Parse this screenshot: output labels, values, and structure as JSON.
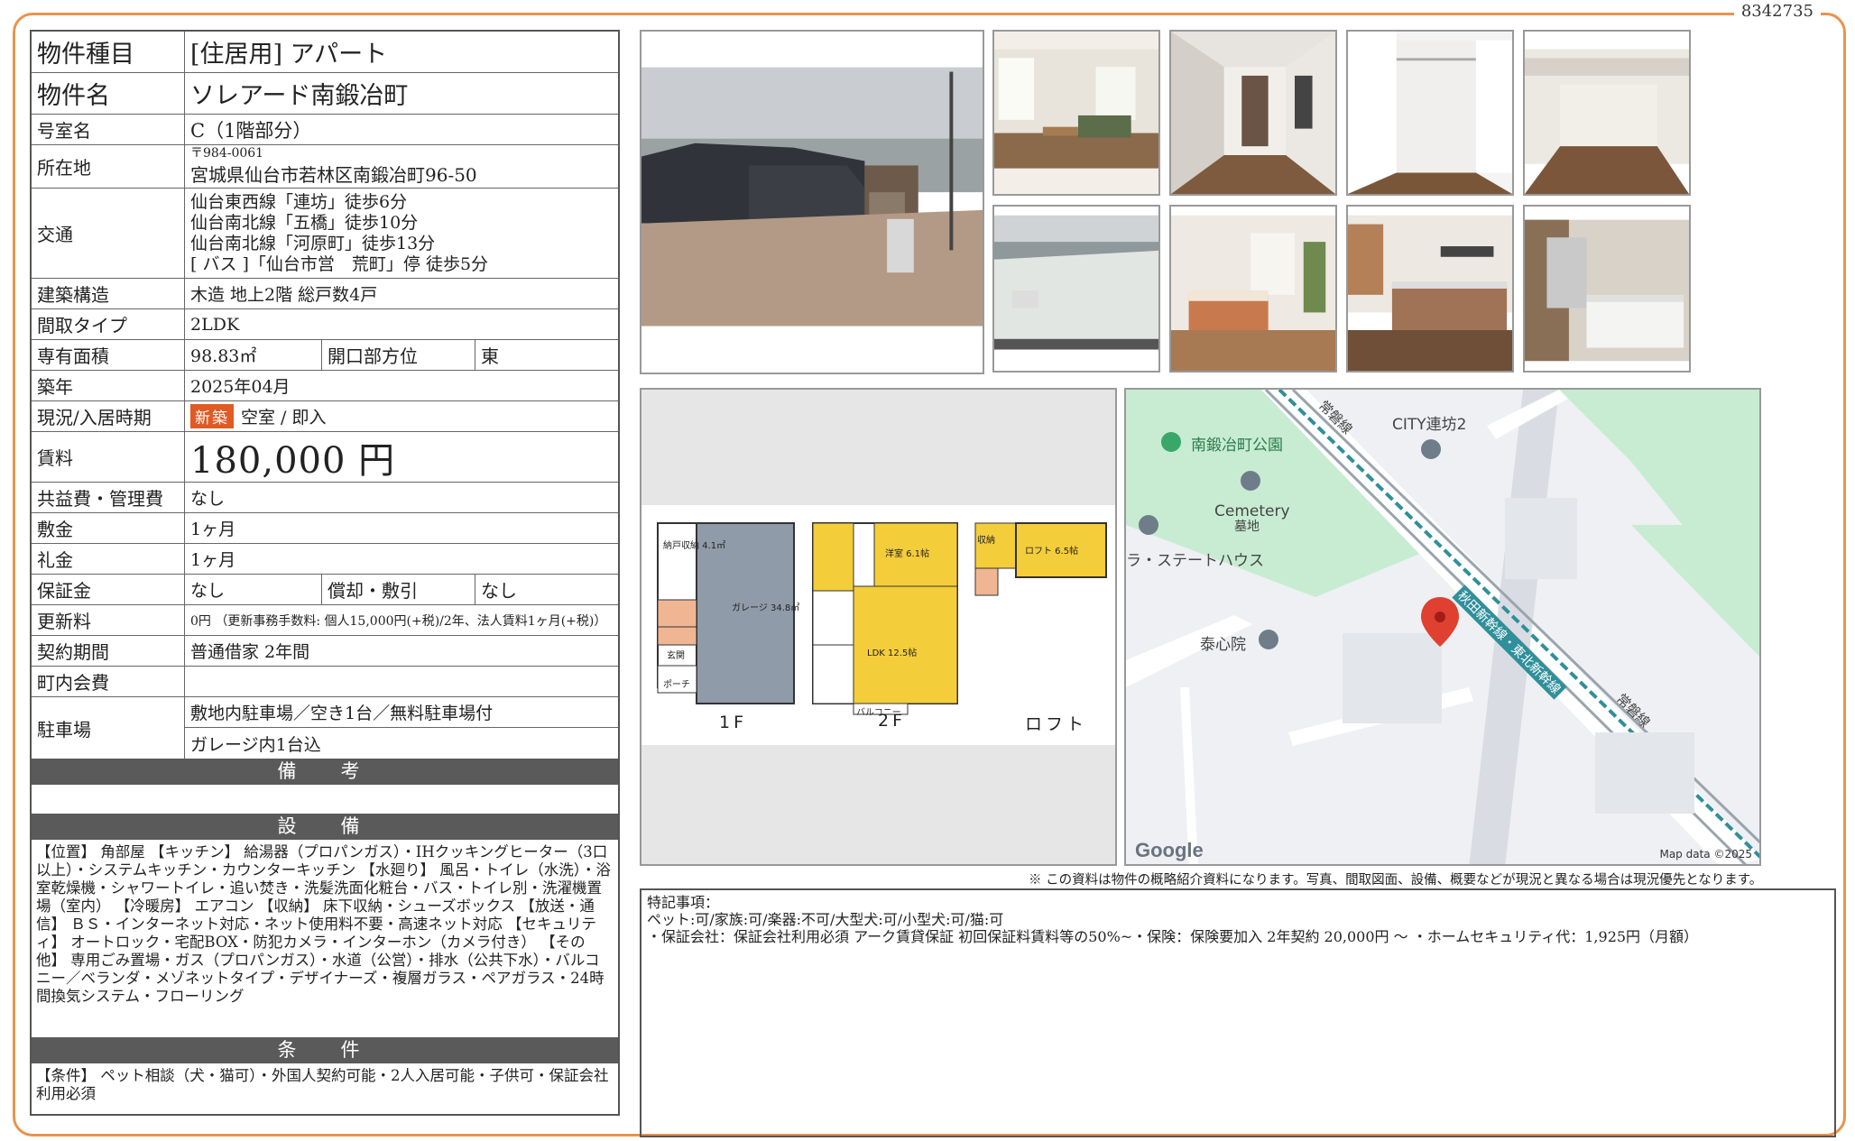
{
  "property_id": "8342735",
  "spec": {
    "type_label": "物件種目",
    "type_value": "[住居用]  アパート",
    "name_label": "物件名",
    "name_value": "ソレアード南鍛冶町",
    "room_label": "号室名",
    "room_value": "C（1階部分）",
    "address_label": "所在地",
    "zip": "〒984-0061",
    "address": "宮城県仙台市若林区南鍛冶町96-50",
    "transit_label": "交通",
    "transit": [
      "仙台東西線「連坊」徒歩6分",
      "仙台南北線「五橋」徒歩10分",
      "仙台南北線「河原町」徒歩13分",
      "[ バス ]「仙台市営　荒町」停 徒歩5分"
    ],
    "structure_label": "建築構造",
    "structure_value": "木造 地上2階 総戸数4戸",
    "layout_label": "間取タイプ",
    "layout_value": "2LDK",
    "area_label": "専有面積",
    "area_value": "98.83㎡",
    "facing_label": "開口部方位",
    "facing_value": "東",
    "built_label": "築年",
    "built_value": "2025年04月",
    "status_label": "現況/入居時期",
    "status_badge": "新築",
    "status_value": "空室 / 即入",
    "rent_label": "賃料",
    "rent_value": "180,000 円",
    "fee_label": "共益費・管理費",
    "fee_value": "なし",
    "deposit_label": "敷金",
    "deposit_value": "1ヶ月",
    "key_money_label": "礼金",
    "key_money_value": "1ヶ月",
    "guarantee_label": "保証金",
    "guarantee_value": "なし",
    "amort_label": "償却・敷引",
    "amort_value": "なし",
    "renewal_label": "更新料",
    "renewal_value": "0円 （更新事務手数料: 個人15,000円(+税)/2年、法人賃料1ヶ月(+税)）",
    "contract_label": "契約期間",
    "contract_value": "普通借家 2年間",
    "town_fee_label": "町内会費",
    "town_fee_value": "",
    "parking_label": "駐車場",
    "parking_value_1": "敷地内駐車場／空き1台／無料駐車場付",
    "parking_value_2": "ガレージ内1台込",
    "remarks_title": "備　考",
    "equipment_title": "設　備",
    "equipment_text": "【位置】 角部屋 【キッチン】 給湯器（プロパンガス）・IHクッキングヒーター（3口以上）・システムキッチン・カウンターキッチン 【水廻り】 風呂・トイレ（水洗）・浴室乾燥機・シャワートイレ・追い焚き・洗髪洗面化粧台・バス・トイレ別・洗濯機置場（室内） 【冷暖房】 エアコン 【収納】 床下収納・シューズボックス 【放送・通信】 ＢＳ・インターネット対応・ネット使用料不要・高速ネット対応 【セキュリティ】 オートロック・宅配BOX・防犯カメラ・インターホン（カメラ付き） 【その他】 専用ごみ置場・ガス（プロパンガス）・水道（公営）・排水（公共下水）・バルコニー／ベランダ・メゾネットタイプ・デザイナーズ・複層ガラス・ペアガラス・24時間換気システム・フローリング",
    "conditions_title": "条　件",
    "conditions_text": "【条件】 ペット相談（犬・猫可）・外国人契約可能・2人入居可能・子供可・保証会社利用必須"
  },
  "floorplan": {
    "labels": [
      "1F",
      "2F",
      "ロフト"
    ],
    "rooms": [
      "納戸収納 4.1㎡",
      "ガレージ 34.8㎡",
      "玄関",
      "ポーチ",
      "洋室 6.1帖",
      "LDK 12.5帖",
      "バルコニー",
      "ロフト 6.5帖",
      "収納"
    ]
  },
  "map": {
    "labels": [
      "南鍛冶町公園",
      "CITY連坊2",
      "Cemetery",
      "墓地",
      "ラ・ステートハウス",
      "泰心院",
      "常磐線",
      "秋田新幹線・東北新幹線",
      "常磐線"
    ],
    "google": "Google",
    "data": "Map data ©2025"
  },
  "disclaimer": "※ この資料は物件の概略紹介資料になります。写真、間取図面、設備、概要などが現況と異なる場合は現況優先となります。",
  "notes": {
    "title": "特記事項：",
    "line1": "ペット:可/家族:可/楽器:不可/大型犬:可/小型犬:可/猫:可",
    "line2": "・保証会社：保証会社利用必須 アーク賃貸保証 初回保証料賃料等の50%~・保険：保険要加入 2年契約 20,000円 ～ ・ホームセキュリティ代：1,925円（月額）"
  },
  "colors": {
    "frame": "#e8944e",
    "band": "#5a5a5a",
    "badge": "#e05a23"
  }
}
